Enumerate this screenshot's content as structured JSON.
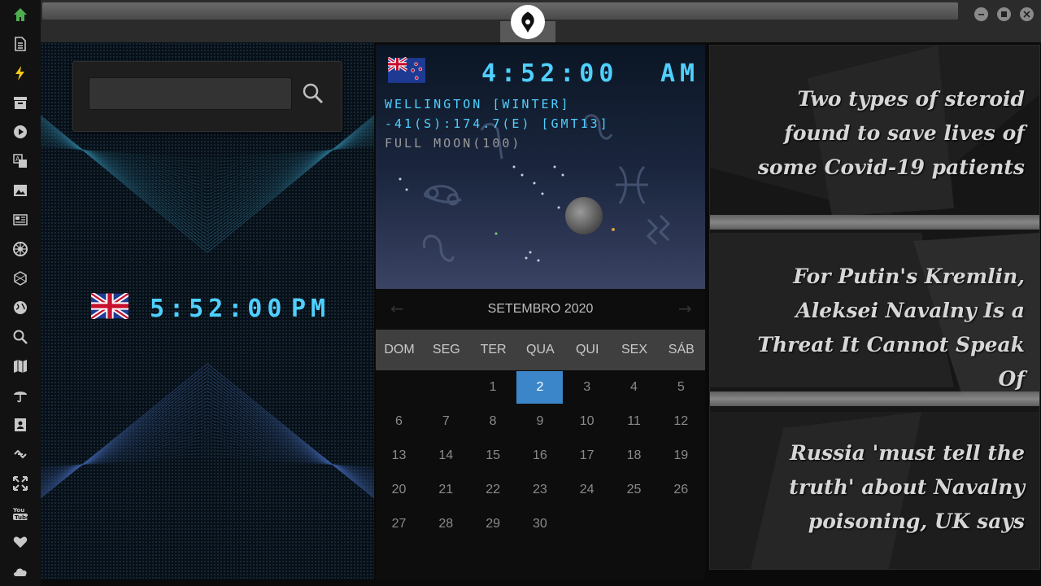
{
  "sidebar": {
    "items": [
      {
        "icon": "home-icon",
        "color": "#4caf50"
      },
      {
        "icon": "document-icon",
        "color": "#c8c8c8"
      },
      {
        "icon": "lightning-icon",
        "color": "#f5c518"
      },
      {
        "icon": "archive-icon",
        "color": "#c8c8c8"
      },
      {
        "icon": "play-icon",
        "color": "#c8c8c8"
      },
      {
        "icon": "translate-icon",
        "color": "#c8c8c8"
      },
      {
        "icon": "image-icon",
        "color": "#c8c8c8"
      },
      {
        "icon": "newspaper-icon",
        "color": "#c8c8c8"
      },
      {
        "icon": "empire-icon",
        "color": "#c8c8c8"
      },
      {
        "icon": "hexagon-icon",
        "color": "#c8c8c8"
      },
      {
        "icon": "globe-icon",
        "color": "#c8c8c8"
      },
      {
        "icon": "search-icon",
        "color": "#c8c8c8"
      },
      {
        "icon": "map-icon",
        "color": "#c8c8c8"
      },
      {
        "icon": "umbrella-icon",
        "color": "#c8c8c8"
      },
      {
        "icon": "contacts-icon",
        "color": "#c8c8c8"
      },
      {
        "icon": "link-icon",
        "color": "#c8c8c8"
      },
      {
        "icon": "expand-icon",
        "color": "#c8c8c8"
      },
      {
        "icon": "youtube-icon",
        "color": "#c8c8c8"
      },
      {
        "icon": "heart-icon",
        "color": "#c8c8c8"
      },
      {
        "icon": "cloud-icon",
        "color": "#c8c8c8"
      }
    ]
  },
  "titlebar": {
    "logo_icon": "rebel-alliance-icon"
  },
  "search": {
    "value": "",
    "icon": "search-icon"
  },
  "uk_clock": {
    "time": "5:52:00",
    "ampm": "PM",
    "flag": "uk-flag-icon"
  },
  "nz_clock": {
    "time": "4:52:00",
    "ampm": "AM",
    "flag": "nz-flag-icon",
    "city_line": "WELLINGTON [WINTER]",
    "coords_line": "-41(S):174.7(E) [GMT13]",
    "moon_line": "FULL MOON(100)"
  },
  "calendar": {
    "title": "SETEMBRO 2020",
    "weekdays": [
      "DOM",
      "SEG",
      "TER",
      "QUA",
      "QUI",
      "SEX",
      "SÁB"
    ],
    "first_weekday_index": 2,
    "days_in_month": 30,
    "selected_day": 2,
    "selected_color": "#3b86c8"
  },
  "news": {
    "headlines": [
      "Two types of steroid found to save lives of some Covid-19 patients",
      "For Putin's Kremlin, Aleksei Navalny Is a Threat It Cannot Speak Of",
      "Russia 'must tell the truth' about Navalny poisoning, UK says"
    ]
  },
  "colors": {
    "lcd": "#4fd0ff",
    "accent_green": "#4caf50"
  }
}
